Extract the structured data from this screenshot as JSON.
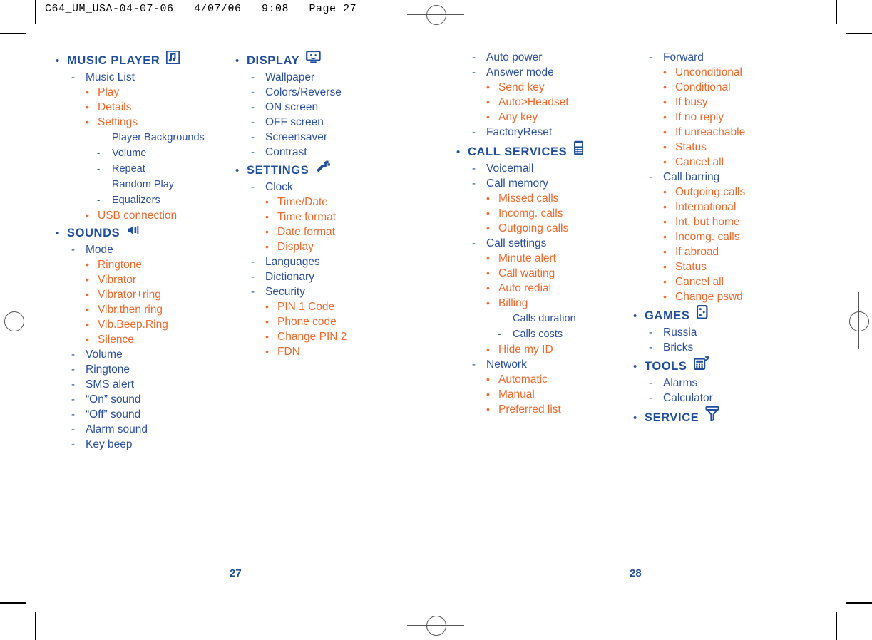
{
  "header": {
    "slug": "C64_UM_USA-04-07-06   4/07/06   9:08   Page 27"
  },
  "colors": {
    "navy": "#1F4E9C",
    "orange": "#F2692C",
    "text_navy": "#2A4F9B"
  },
  "page_numbers": {
    "left": "27",
    "right": "28"
  },
  "columns": [
    {
      "id": "col1",
      "items": [
        {
          "level": 1,
          "label": "MUSIC PLAYER",
          "icon": "music-note-icon"
        },
        {
          "level": 2,
          "label": "Music List"
        },
        {
          "level": 3,
          "label": "Play"
        },
        {
          "level": 3,
          "label": "Details"
        },
        {
          "level": 3,
          "label": "Settings"
        },
        {
          "level": 4,
          "label": "Player Backgrounds"
        },
        {
          "level": 4,
          "label": "Volume"
        },
        {
          "level": 4,
          "label": "Repeat"
        },
        {
          "level": 4,
          "label": "Random Play"
        },
        {
          "level": 4,
          "label": "Equalizers"
        },
        {
          "level": 3,
          "label": "USB connection"
        },
        {
          "level": 1,
          "label": "SOUNDS",
          "icon": "speaker-icon"
        },
        {
          "level": 2,
          "label": "Mode"
        },
        {
          "level": 3,
          "label": "Ringtone"
        },
        {
          "level": 3,
          "label": "Vibrator"
        },
        {
          "level": 3,
          "label": "Vibrator+ring"
        },
        {
          "level": 3,
          "label": "Vibr.then ring"
        },
        {
          "level": 3,
          "label": "Vib.Beep.Ring"
        },
        {
          "level": 3,
          "label": "Silence"
        },
        {
          "level": 2,
          "label": "Volume"
        },
        {
          "level": 2,
          "label": "Ringtone"
        },
        {
          "level": 2,
          "label": "SMS alert"
        },
        {
          "level": 2,
          "label": "“On” sound"
        },
        {
          "level": 2,
          "label": "“Off” sound"
        },
        {
          "level": 2,
          "label": "Alarm sound"
        },
        {
          "level": 2,
          "label": "Key beep"
        }
      ]
    },
    {
      "id": "col2",
      "items": [
        {
          "level": 1,
          "label": "DISPLAY",
          "icon": "monitor-icon"
        },
        {
          "level": 2,
          "label": "Wallpaper"
        },
        {
          "level": 2,
          "label": "Colors/Reverse"
        },
        {
          "level": 2,
          "label": "ON screen"
        },
        {
          "level": 2,
          "label": "OFF screen"
        },
        {
          "level": 2,
          "label": "Screensaver"
        },
        {
          "level": 2,
          "label": "Contrast"
        },
        {
          "level": 1,
          "label": "SETTINGS",
          "icon": "wrench-icon"
        },
        {
          "level": 2,
          "label": "Clock"
        },
        {
          "level": 3,
          "label": "Time/Date"
        },
        {
          "level": 3,
          "label": "Time format"
        },
        {
          "level": 3,
          "label": "Date format"
        },
        {
          "level": 3,
          "label": "Display"
        },
        {
          "level": 2,
          "label": "Languages"
        },
        {
          "level": 2,
          "label": "Dictionary"
        },
        {
          "level": 2,
          "label": "Security"
        },
        {
          "level": 3,
          "label": "PIN 1 Code"
        },
        {
          "level": 3,
          "label": "Phone code"
        },
        {
          "level": 3,
          "label": "Change PIN 2"
        },
        {
          "level": 3,
          "label": "FDN"
        }
      ]
    },
    {
      "id": "col3",
      "items": [
        {
          "level": 2,
          "label": "Auto power"
        },
        {
          "level": 2,
          "label": "Answer mode"
        },
        {
          "level": 3,
          "label": "Send key"
        },
        {
          "level": 3,
          "label": "Auto>Headset"
        },
        {
          "level": 3,
          "label": "Any key"
        },
        {
          "level": 2,
          "label": "FactoryReset"
        },
        {
          "level": 1,
          "label": "CALL SERVICES",
          "icon": "mobile-phone-icon"
        },
        {
          "level": 2,
          "label": "Voicemail"
        },
        {
          "level": 2,
          "label": "Call memory"
        },
        {
          "level": 3,
          "label": "Missed calls"
        },
        {
          "level": 3,
          "label": "Incomg. calls"
        },
        {
          "level": 3,
          "label": "Outgoing calls"
        },
        {
          "level": 2,
          "label": "Call settings"
        },
        {
          "level": 3,
          "label": "Minute alert"
        },
        {
          "level": 3,
          "label": "Call waiting"
        },
        {
          "level": 3,
          "label": "Auto redial"
        },
        {
          "level": 3,
          "label": "Billing"
        },
        {
          "level": 4,
          "label": "Calls duration"
        },
        {
          "level": 4,
          "label": "Calls costs"
        },
        {
          "level": 3,
          "label": "Hide my ID"
        },
        {
          "level": 2,
          "label": "Network"
        },
        {
          "level": 3,
          "label": "Automatic"
        },
        {
          "level": 3,
          "label": "Manual"
        },
        {
          "level": 3,
          "label": "Preferred list"
        }
      ]
    },
    {
      "id": "col4",
      "items": [
        {
          "level": 2,
          "label": "Forward"
        },
        {
          "level": 3,
          "label": "Unconditional"
        },
        {
          "level": 3,
          "label": "Conditional"
        },
        {
          "level": 3,
          "label": "If busy"
        },
        {
          "level": 3,
          "label": "If no reply"
        },
        {
          "level": 3,
          "label": "If unreachable"
        },
        {
          "level": 3,
          "label": "Status"
        },
        {
          "level": 3,
          "label": "Cancel all"
        },
        {
          "level": 2,
          "label": "Call barring"
        },
        {
          "level": 3,
          "label": "Outgoing calls"
        },
        {
          "level": 3,
          "label": "International"
        },
        {
          "level": 3,
          "label": "Int. but home"
        },
        {
          "level": 3,
          "label": "Incomg. calls"
        },
        {
          "level": 3,
          "label": "If abroad"
        },
        {
          "level": 3,
          "label": "Status"
        },
        {
          "level": 3,
          "label": "Cancel all"
        },
        {
          "level": 3,
          "label": "Change pswd"
        },
        {
          "level": 1,
          "label": "GAMES",
          "icon": "dice-icon"
        },
        {
          "level": 2,
          "label": "Russia"
        },
        {
          "level": 2,
          "label": "Bricks"
        },
        {
          "level": 1,
          "label": "TOOLS",
          "icon": "calculator-icon"
        },
        {
          "level": 2,
          "label": "Alarms"
        },
        {
          "level": 2,
          "label": "Calculator"
        },
        {
          "level": 1,
          "label": "SERVICE",
          "icon": "funnel-antenna-icon"
        }
      ]
    }
  ],
  "bullets": {
    "level1": "•",
    "level2": "-",
    "level3": "•",
    "level4": "-"
  }
}
